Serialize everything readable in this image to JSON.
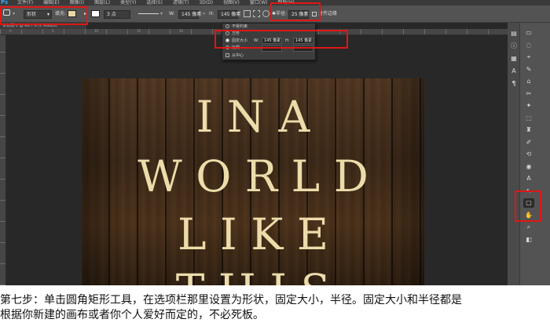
{
  "app": {
    "logo": "Ps"
  },
  "menubar": {
    "items": [
      "文件(F)",
      "编辑(E)",
      "图像(I)",
      "图层(L)",
      "类型(Y)",
      "选择(S)",
      "滤镜(T)",
      "3D(D)",
      "视图(V)",
      "窗口(W)",
      "帮助(H)"
    ]
  },
  "options_bar": {
    "tool_mode": "形状",
    "fill_label": "填充:",
    "stroke_width": "3 点",
    "w_label": "W:",
    "w_value": "145 像素",
    "h_label": "H:",
    "h_value": "145 像素",
    "radius_label": "半径:",
    "radius_value": "25 像素",
    "align_edges": "对齐边缘",
    "fill_color": "#e9d8a6",
    "stroke_color": "#ffffff"
  },
  "document_tab": {
    "title": "未标题-1 @ 66.7% (I, RGB/8)"
  },
  "ruler_ticks": [
    "0",
    "5",
    "10",
    "15",
    "20",
    "25",
    "30"
  ],
  "dropdown": {
    "unconstrained": "不受约束",
    "square": "方形",
    "fixed_size": "固定大小",
    "w_label": "W:",
    "w_value": "145 像素",
    "h_label": "H:",
    "h_value": "145 像素",
    "proportional": "比例",
    "from_center": "从中心"
  },
  "canvas": {
    "lines": [
      "I N A",
      "W O R L D",
      "L I K E",
      "T H I S"
    ]
  },
  "tools": [
    "▭",
    "◌",
    "⌖",
    "✎",
    "⌂",
    "✂",
    "✦",
    "⬚",
    "♜",
    "✐",
    "⟲",
    "◉",
    "A",
    "↖",
    "▢",
    "✋",
    "⌕",
    "◧"
  ],
  "highlight_color": "#e01616",
  "caption": {
    "line1": "第七步：单击圆角矩形工具，在选项栏那里设置为形状，固定大小，半径。固定大小和半径都是",
    "line2": "根据你新建的画布或者你个人爱好而定的，不必死板。"
  }
}
